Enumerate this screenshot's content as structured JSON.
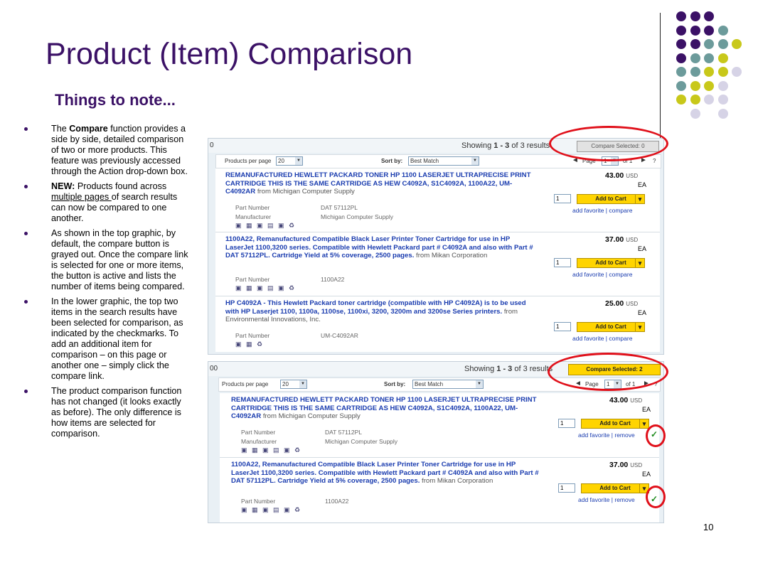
{
  "slide": {
    "title": "Product  (Item) Comparison",
    "subtitle": "Things to note...",
    "page_number": "10"
  },
  "bullets": [
    {
      "pre": "The ",
      "bold": "Compare",
      "text": " function provides a side by side, detailed comparison of two or more products.  This feature was previously accessed through the Action drop-down box."
    },
    {
      "bold": "NEW:",
      "pre2": " Products found across ",
      "underline": "multiple pages ",
      "text": "of search results can now be compared to one another."
    },
    {
      "text": "As shown in the top graphic, by default, the compare button is grayed out. Once the compare link is selected for one or more items, the button is active and lists the number of items being compared."
    },
    {
      "text": "In the lower graphic, the top two items in the search results have been selected for comparison, as indicated by the checkmarks. To add an additional item for comparison – on this page or another one – simply click the compare link."
    },
    {
      "text": "The  product comparison function has not changed (it looks exactly as before). The only difference is how items are selected for comparison."
    }
  ],
  "screens": {
    "common": {
      "prefix_top": "0",
      "prefix_bottom": "00",
      "showing_pre": "Showing ",
      "showing_range": "1 - 3",
      "showing_post": " of 3 results",
      "per_page_label": "Products per page",
      "per_page_value": "20",
      "sort_label": "Sort by:",
      "sort_value": "Best Match",
      "page_label": "Page",
      "page_value": "1",
      "page_of": "of 1",
      "help": "?",
      "add_to_cart": "Add to Cart",
      "qty": "1",
      "add_favorite": "add favorite",
      "sep": " | ",
      "compare": "compare",
      "remove": "remove",
      "part_label": "Part Number",
      "mfr_label": "Manufacturer",
      "usd": "USD",
      "ea": "EA",
      "icons": "▣ ▦ ▣ ▤ ▣ ♻"
    },
    "top_compare_button": "Compare Selected: 0",
    "bottom_compare_button": "Compare Selected: 2",
    "items": [
      {
        "desc": "REMANUFACTURED HEWLETT PACKARD TONER HP 1100 LASERJET ULTRAPRECISE PRINT CARTRIDGE THIS IS THE SAME CARTRIDGE AS HEW C4092A, S1C4092A, 1100A22, UM-C4092AR",
        "source": "from Michigan Computer Supply",
        "part": "DAT 57112PL",
        "mfr": "Michigan Computer Supply",
        "price": "43.00"
      },
      {
        "desc": "1100A22, Remanufactured Compatible Black Laser Printer Toner Cartridge for use in HP LaserJet 1100,3200 series. Compatible with Hewlett Packard part # C4092A and also with Part # DAT 57112PL. Cartridge Yield at 5% coverage, 2500 pages.",
        "source": "from Mikan Corporation",
        "part": "1100A22",
        "price": "37.00"
      },
      {
        "desc": "HP C4092A - This Hewlett Packard toner cartridge (compatible with HP C4092A) is to be used with HP Laserjet 1100, 1100a, 1100se, 1100xi, 3200, 3200m and 3200se Series printers.",
        "source": "from Environmental Innovations, Inc.",
        "part": "UM-C4092AR",
        "price": "25.00"
      }
    ]
  },
  "colors": {
    "title": "#3b1166",
    "accent_purple": "#3b1166",
    "accent_teal": "#6c9b9b",
    "accent_lime": "#c8c81a",
    "accent_lilac": "#d6d3e6",
    "highlight_ring": "#e0101a"
  }
}
